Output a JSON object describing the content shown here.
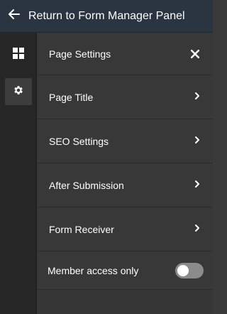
{
  "header": {
    "back_icon": "arrow-left-icon",
    "title": "Return to Form Manager Panel"
  },
  "rail": {
    "items": [
      {
        "icon": "dashboard-grid-icon",
        "active": false
      },
      {
        "icon": "gear-icon",
        "active": true
      }
    ]
  },
  "panel": {
    "title": "Page Settings",
    "close_icon": "close-icon",
    "items": [
      {
        "label": "Page Title",
        "icon": "chevron-right-icon"
      },
      {
        "label": "SEO Settings",
        "icon": "chevron-right-icon"
      },
      {
        "label": "After Submission",
        "icon": "chevron-right-icon"
      },
      {
        "label": "Form Receiver",
        "icon": "chevron-right-icon"
      }
    ],
    "member_toggle": {
      "label": "Member access only",
      "enabled": false
    }
  },
  "colors": {
    "header_bg": "#2b3441",
    "rail_bg": "#262626",
    "panel_bg": "#383838",
    "toggle_off": "#8b8b8b"
  }
}
